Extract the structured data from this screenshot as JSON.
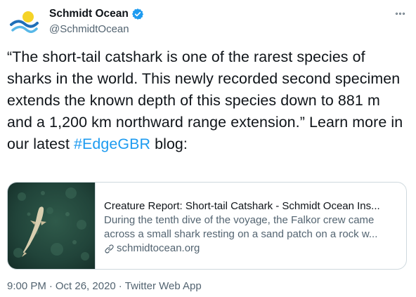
{
  "author": {
    "display_name": "Schmidt Ocean",
    "handle": "@SchmidtOcean",
    "verified_color": "#1d9bf0",
    "avatar_colors": {
      "sun": "#f5d327",
      "wave_blue": "#1f6fb8",
      "wave_light": "#58b8e8"
    }
  },
  "menu": {
    "icon": "more-horizontal-icon"
  },
  "tweet": {
    "text_before": "“The short-tail catshark is one of the rarest species of sharks in the world. This newly recorded second specimen extends the known depth of this species down to 881 m and a 1,200 km northward range extension.” Learn more in our latest ",
    "hashtag": "#EdgeGBR",
    "text_after": " blog:",
    "link_color": "#1d9bf0"
  },
  "card": {
    "title": "Creature Report: Short-tail Catshark - Schmidt Ocean Ins...",
    "description_line1": "During the tenth dive of the voyage, the Falkor crew came",
    "description_line2": "across a small shark resting on a sand patch on a rock w...",
    "domain": "schmidtocean.org",
    "thumbnail": "catshark-seafloor-photo"
  },
  "footer": {
    "time": "9:00 PM",
    "sep1": "·",
    "date": "Oct 26, 2020",
    "sep2": "·",
    "source": "Twitter Web App"
  }
}
